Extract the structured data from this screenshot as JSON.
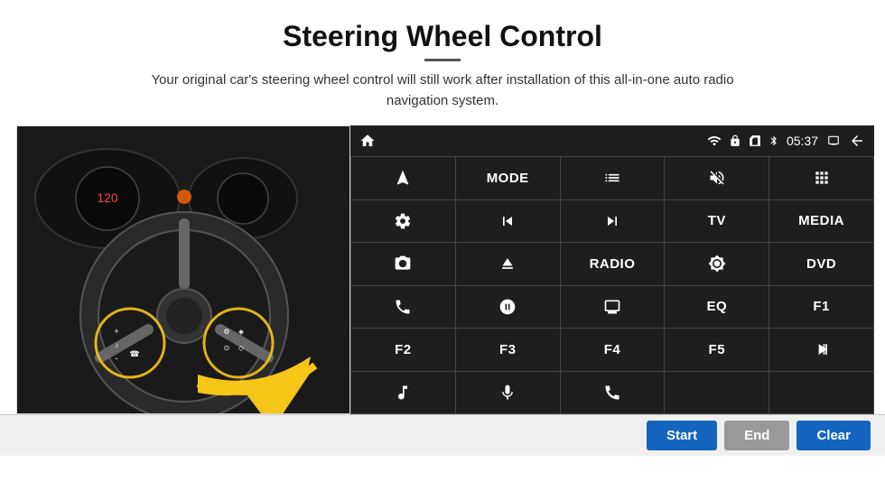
{
  "header": {
    "title": "Steering Wheel Control",
    "subtitle": "Your original car's steering wheel control will still work after installation of this all-in-one auto radio navigation system.",
    "divider": true
  },
  "panel": {
    "status_bar": {
      "time": "05:37"
    },
    "buttons": [
      {
        "id": "nav",
        "type": "icon",
        "icon": "navigate"
      },
      {
        "id": "mode",
        "type": "text",
        "label": "MODE"
      },
      {
        "id": "list",
        "type": "icon",
        "icon": "list"
      },
      {
        "id": "mute",
        "type": "icon",
        "icon": "mute"
      },
      {
        "id": "apps",
        "type": "icon",
        "icon": "apps"
      },
      {
        "id": "settings",
        "type": "icon",
        "icon": "settings"
      },
      {
        "id": "prev",
        "type": "icon",
        "icon": "prev"
      },
      {
        "id": "next",
        "type": "icon",
        "icon": "next"
      },
      {
        "id": "tv",
        "type": "text",
        "label": "TV"
      },
      {
        "id": "media",
        "type": "text",
        "label": "MEDIA"
      },
      {
        "id": "cam360",
        "type": "icon",
        "icon": "cam360"
      },
      {
        "id": "eject",
        "type": "icon",
        "icon": "eject"
      },
      {
        "id": "radio",
        "type": "text",
        "label": "RADIO"
      },
      {
        "id": "brightness",
        "type": "icon",
        "icon": "brightness"
      },
      {
        "id": "dvd",
        "type": "text",
        "label": "DVD"
      },
      {
        "id": "phone",
        "type": "icon",
        "icon": "phone"
      },
      {
        "id": "swipe",
        "type": "icon",
        "icon": "swipe"
      },
      {
        "id": "display",
        "type": "icon",
        "icon": "display"
      },
      {
        "id": "eq",
        "type": "text",
        "label": "EQ"
      },
      {
        "id": "f1",
        "type": "text",
        "label": "F1"
      },
      {
        "id": "f2",
        "type": "text",
        "label": "F2"
      },
      {
        "id": "f3",
        "type": "text",
        "label": "F3"
      },
      {
        "id": "f4",
        "type": "text",
        "label": "F4"
      },
      {
        "id": "f5",
        "type": "text",
        "label": "F5"
      },
      {
        "id": "playpause",
        "type": "icon",
        "icon": "playpause"
      },
      {
        "id": "music",
        "type": "icon",
        "icon": "music"
      },
      {
        "id": "mic",
        "type": "icon",
        "icon": "mic"
      },
      {
        "id": "hangup",
        "type": "icon",
        "icon": "hangup"
      },
      {
        "id": "empty1",
        "type": "empty"
      },
      {
        "id": "empty2",
        "type": "empty"
      }
    ]
  },
  "footer": {
    "start_label": "Start",
    "end_label": "End",
    "clear_label": "Clear"
  }
}
